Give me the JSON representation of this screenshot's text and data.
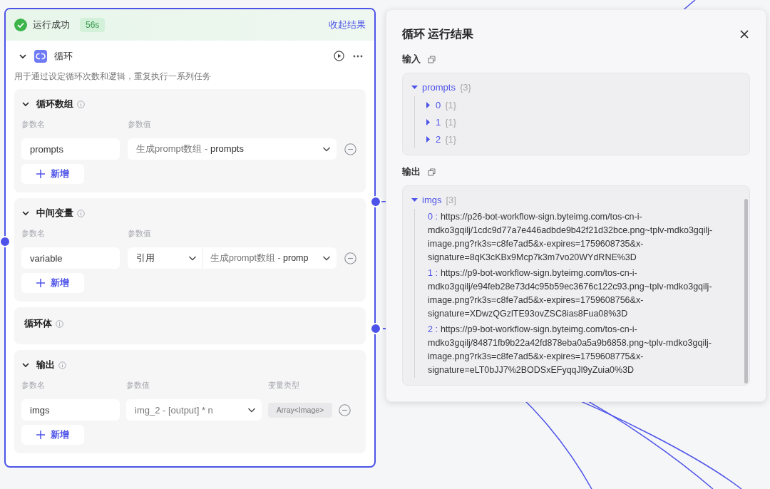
{
  "node": {
    "status": "运行成功",
    "duration": "56s",
    "collapse_link": "收起结果",
    "title": "循环",
    "expanded": true,
    "description": "用于通过设定循环次数和逻辑，重复执行一系列任务",
    "sections": [
      {
        "kind": "params",
        "title": "循环数组",
        "expanded": true,
        "column_labels": [
          "参数名",
          "参数值"
        ],
        "rows": [
          {
            "name": "prompts",
            "value_source": "生成prompt数组 -",
            "value_field": "prompts"
          }
        ],
        "add_button": "新增"
      },
      {
        "kind": "params",
        "title": "中间变量",
        "expanded": true,
        "column_labels": [
          "参数名",
          "参数值"
        ],
        "rows": [
          {
            "name": "variable",
            "mode": "引用",
            "value_source": "生成prompt数组 -",
            "value_field": "promp"
          }
        ],
        "add_button": "新增"
      },
      {
        "kind": "body",
        "title": "循环体"
      },
      {
        "kind": "params",
        "title": "输出",
        "expanded": true,
        "column_labels": [
          "参数名",
          "参数值",
          "变量类型"
        ],
        "rows": [
          {
            "name": "imgs",
            "value_source": "img_2 - [output] * n",
            "type": "Array<Image>"
          }
        ],
        "add_button": "新增"
      }
    ]
  },
  "panel": {
    "title": "循环 运行结果",
    "input": {
      "label": "输入",
      "tree": {
        "key": "prompts",
        "count": "{3}",
        "expanded": true,
        "children": [
          {
            "key": "0",
            "count": "{1}",
            "expanded": false
          },
          {
            "key": "1",
            "count": "{1}",
            "expanded": false
          },
          {
            "key": "2",
            "count": "{1}",
            "expanded": false
          }
        ]
      }
    },
    "output": {
      "label": "输出",
      "tree": {
        "key": "imgs",
        "count": "[3]",
        "expanded": true,
        "children": [
          {
            "key": "0 :",
            "value": "https://p26-bot-workflow-sign.byteimg.com/tos-cn-i-mdko3gqilj/1cdc9d77a7e446adbde9b42f21d32bce.png~tplv-mdko3gqilj-image.png?rk3s=c8fe7ad5&x-expires=1759608735&x-signature=8qK3cKBx9Mcp7k3m7vo20WYdRNE%3D"
          },
          {
            "key": "1 :",
            "value": "https://p9-bot-workflow-sign.byteimg.com/tos-cn-i-mdko3gqilj/e94feb28e73d4c95b59ec3676c122c93.png~tplv-mdko3gqilj-image.png?rk3s=c8fe7ad5&x-expires=1759608756&x-signature=XDwzQGzlTE93ovZSC8ias8Fua08%3D"
          },
          {
            "key": "2 :",
            "value": "https://p9-bot-workflow-sign.byteimg.com/tos-cn-i-mdko3gqilj/84871fb9b22a42fd878eba0a5a9b6858.png~tplv-mdko3gqilj-image.png?rk3s=c8fe7ad5&x-expires=1759608775&x-signature=eLT0bJJ7%2BODSxEFyqqJl9yZuia0%3D"
          }
        ]
      }
    }
  }
}
